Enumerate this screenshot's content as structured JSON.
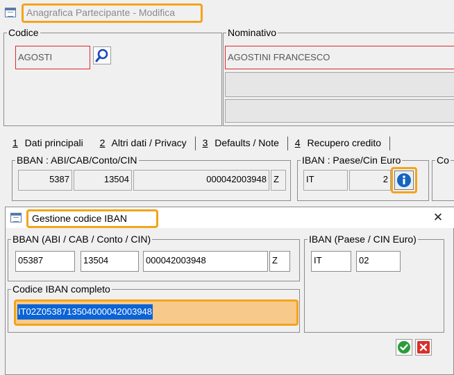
{
  "main_window": {
    "title": "Anagrafica Partecipante - Modifica",
    "codice": {
      "legend": "Codice",
      "value": "AGOSTI"
    },
    "nominativo": {
      "legend": "Nominativo",
      "value": "AGOSTINI FRANCESCO",
      "line2": "",
      "line3": ""
    },
    "tabs": [
      {
        "num": "1",
        "label": " Dati principali"
      },
      {
        "num": "2",
        "label": " Altri dati / Privacy"
      },
      {
        "num": "3",
        "label": " Defaults / Note"
      },
      {
        "num": "4",
        "label": " Recupero credito"
      }
    ],
    "bban": {
      "legend": "BBAN : ABI/CAB/Conto/CIN",
      "abi": "5387",
      "cab": "13504",
      "conto": "000042003948",
      "cin": "Z"
    },
    "iban": {
      "legend": "IBAN : Paese/Cin Euro",
      "paese": "IT",
      "cin_euro": "2"
    },
    "partial_legend": "Co"
  },
  "dialog": {
    "title": "Gestione codice IBAN",
    "close_glyph": "✕",
    "bban": {
      "legend": "BBAN (ABI / CAB / Conto / CIN)",
      "abi": "05387",
      "cab": "13504",
      "conto": "000042003948",
      "cin": "Z"
    },
    "iban": {
      "legend": "IBAN (Paese / CIN Euro)",
      "paese": "IT",
      "cin_euro": "02"
    },
    "completo": {
      "legend": "Codice IBAN completo",
      "value": "IT02Z0538713504000042003948"
    },
    "ok_icon": "checkmark-icon",
    "cancel_icon": "cancel-icon"
  },
  "colors": {
    "highlight": "#f3a41b",
    "selection": "#0a64d8",
    "ok_green": "#2a9d3a",
    "cancel_red": "#d9302a",
    "info_blue": "#1565c0"
  }
}
